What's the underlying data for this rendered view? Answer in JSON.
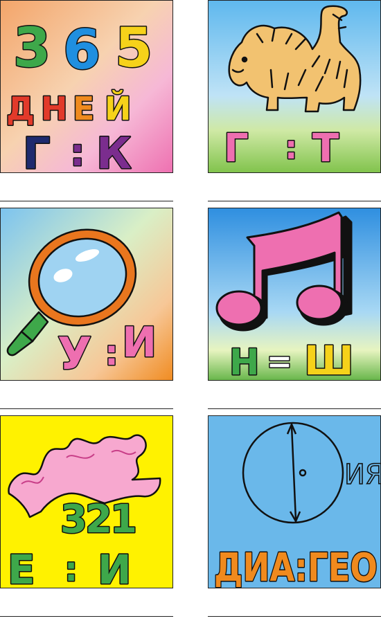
{
  "puzzles": [
    {
      "lines": [
        "365",
        "ДНЕЙ",
        "Г:К"
      ],
      "icon": "calendar-text"
    },
    {
      "lines": [
        "Г:Т"
      ],
      "icon": "tiger-icon"
    },
    {
      "lines": [
        "У:И"
      ],
      "icon": "magnifying-glass-icon"
    },
    {
      "lines": [
        "Н=Ш"
      ],
      "icon": "music-note-icon"
    },
    {
      "lines": [
        "321",
        "Е:И"
      ],
      "icon": "ribbon-icon"
    },
    {
      "lines": [
        "ИЯ",
        "ДИА:ГЕО"
      ],
      "icon": "circle-diameter-icon"
    }
  ],
  "colors": {
    "pink": "#ee6fb0",
    "green": "#3ea84a",
    "blue": "#1f8fe0",
    "yellow": "#f6d21a",
    "red": "#e23a2a",
    "orange": "#f08a1e",
    "navy": "#1e2a6e",
    "purple": "#7b2d8e"
  }
}
